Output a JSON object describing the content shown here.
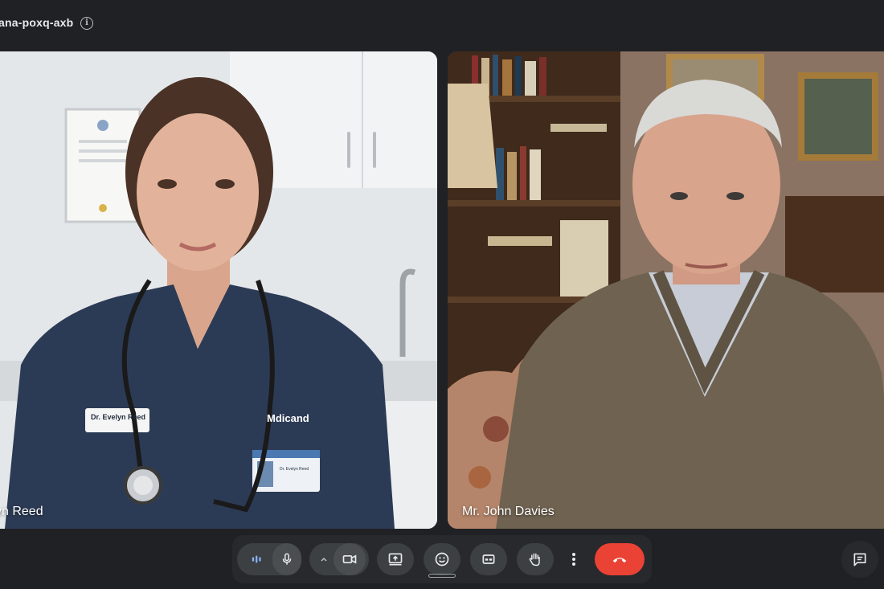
{
  "header": {
    "meeting_code": "ana-poxq-axb",
    "info_icon": "info-icon"
  },
  "participants": [
    {
      "name": "yn Reed",
      "badge_name": "Dr. Evelyn Reed",
      "org_logo_text": "Mdicand",
      "id_card_name": "Dr. Evelyn Reed"
    },
    {
      "name": "Mr. John Davies"
    }
  ],
  "controls": {
    "audio_level_icon": "audio-level-icon",
    "mic_icon": "microphone-icon",
    "camera_options_icon": "chevron-up-icon",
    "camera_icon": "video-camera-icon",
    "present_icon": "present-screen-icon",
    "reactions_icon": "emoji-icon",
    "captions_icon": "captions-icon",
    "raise_hand_icon": "raise-hand-icon",
    "more_icon": "more-vertical-icon",
    "end_call_icon": "end-call-icon",
    "chat_icon": "chat-icon"
  },
  "colors": {
    "background": "#202124",
    "control_bg": "#3c4043",
    "end_call": "#ea4335",
    "text": "#e8eaed"
  }
}
